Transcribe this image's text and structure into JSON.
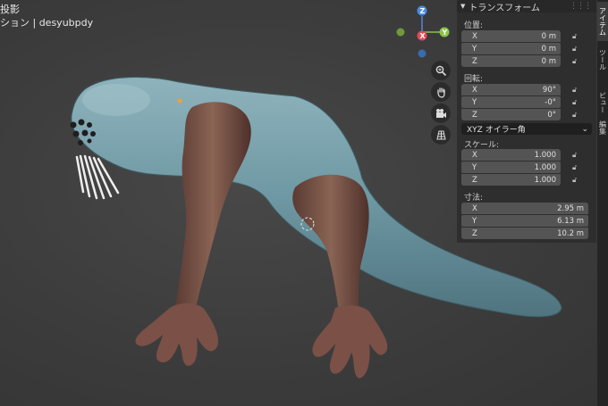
{
  "viewport": {
    "title": "投影",
    "collection": "ション | desyubpdy"
  },
  "gizmo": {
    "x_label": "X",
    "y_label": "Y",
    "z_label": "Z",
    "x_color": "#e04a5a",
    "y_color": "#8bc34a",
    "z_color": "#4a8be0"
  },
  "nav_buttons": [
    "zoom-icon",
    "hand-icon",
    "camera-icon",
    "grid-icon"
  ],
  "npanel": {
    "header": "トランスフォーム",
    "location": {
      "label": "位置:",
      "x": {
        "axis": "X",
        "value": "0 m"
      },
      "y": {
        "axis": "Y",
        "value": "0 m"
      },
      "z": {
        "axis": "Z",
        "value": "0 m"
      }
    },
    "rotation": {
      "label": "回転:",
      "x": {
        "axis": "X",
        "value": "90°"
      },
      "y": {
        "axis": "Y",
        "value": "-0°"
      },
      "z": {
        "axis": "Z",
        "value": "0°"
      }
    },
    "rotation_mode": "XYZ オイラー角",
    "scale": {
      "label": "スケール:",
      "x": {
        "axis": "X",
        "value": "1.000"
      },
      "y": {
        "axis": "Y",
        "value": "1.000"
      },
      "z": {
        "axis": "Z",
        "value": "1.000"
      }
    },
    "dimensions": {
      "label": "寸法:",
      "x": {
        "axis": "X",
        "value": "2.95 m"
      },
      "y": {
        "axis": "Y",
        "value": "6.13 m"
      },
      "z": {
        "axis": "Z",
        "value": "10.2 m"
      }
    }
  },
  "tabs": {
    "item": "アイテム",
    "tool": "ツール",
    "view": "ビュー",
    "edit": "編集"
  }
}
